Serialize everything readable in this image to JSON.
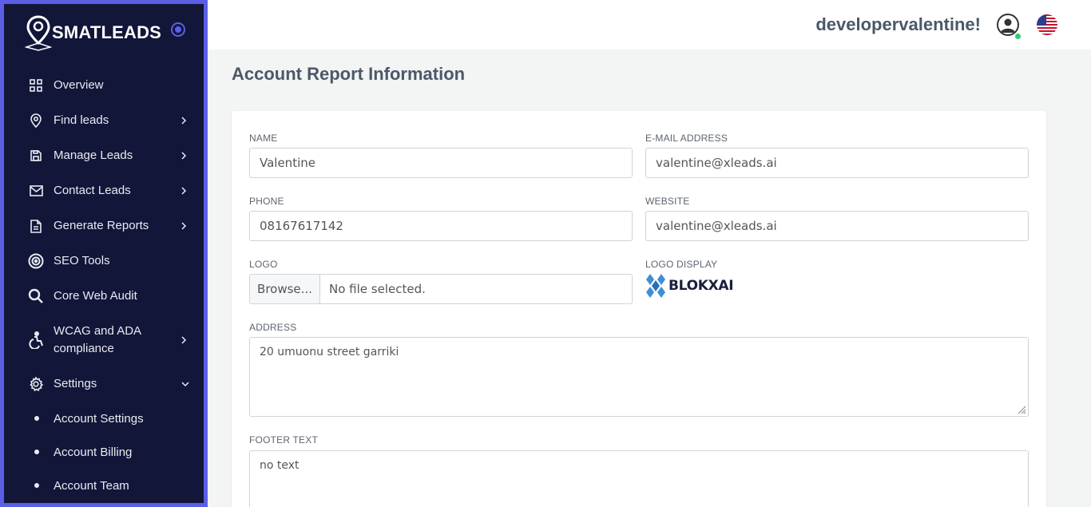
{
  "brand": {
    "name": "SMATLEADS",
    "accent": "#5a5fe6"
  },
  "sidebar": {
    "items": [
      {
        "label": "Overview",
        "icon": "grid-icon",
        "chevron": ""
      },
      {
        "label": "Find leads",
        "icon": "map-pin-icon",
        "chevron": "right"
      },
      {
        "label": "Manage Leads",
        "icon": "save-icon",
        "chevron": "right"
      },
      {
        "label": "Contact Leads",
        "icon": "mail-icon",
        "chevron": "right"
      },
      {
        "label": "Generate Reports",
        "icon": "file-text-icon",
        "chevron": "right"
      },
      {
        "label": "SEO Tools",
        "icon": "target-icon",
        "chevron": ""
      },
      {
        "label": "Core Web Audit",
        "icon": "search-icon",
        "chevron": ""
      },
      {
        "label": "WCAG and ADA compliance",
        "icon": "accessibility-icon",
        "chevron": "right"
      },
      {
        "label": "Settings",
        "icon": "gear-icon",
        "chevron": "down"
      }
    ],
    "sub_items": [
      {
        "label": "Account Settings"
      },
      {
        "label": "Account Billing"
      },
      {
        "label": "Account Team"
      }
    ]
  },
  "header": {
    "username": "developervalentine!",
    "avatar_icon": "user-circle-icon",
    "flag_icon": "us-flag-icon"
  },
  "page": {
    "title": "Account Report Information"
  },
  "form": {
    "name": {
      "label": "NAME",
      "value": "Valentine"
    },
    "email": {
      "label": "E-MAIL ADDRESS",
      "value": "valentine@xleads.ai"
    },
    "phone": {
      "label": "PHONE",
      "value": "08167617142"
    },
    "website": {
      "label": "WEBSITE",
      "value": "valentine@xleads.ai"
    },
    "logo": {
      "label": "LOGO",
      "button": "Browse...",
      "file": "No file selected."
    },
    "logo_display": {
      "label": "LOGO DISPLAY",
      "text": "BLOKXAI"
    },
    "address": {
      "label": "ADDRESS",
      "value": "20 umuonu street garriki"
    },
    "footer": {
      "label": "FOOTER TEXT",
      "value": "no text"
    }
  }
}
